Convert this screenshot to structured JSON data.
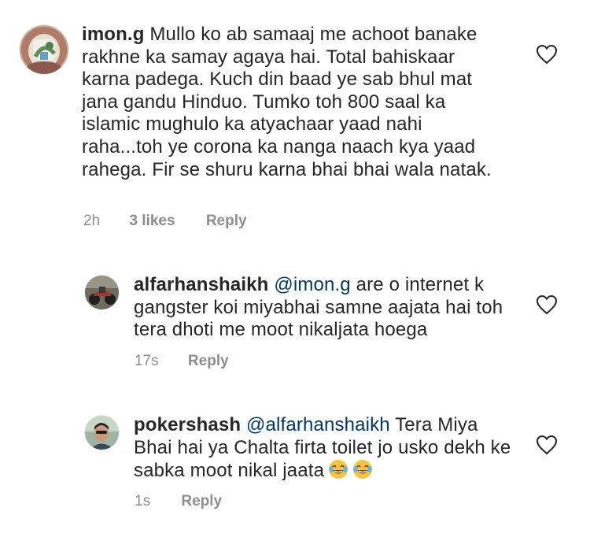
{
  "comments": [
    {
      "username": "imon.g",
      "mention": "",
      "text": "Mullo ko ab samaaj me achoot banake rakhne ka samay agaya hai. Total bahiskaar karna padega. Kuch din baad ye sab bhul mat jana gandu Hinduo. Tumko toh 800 saal ka islamic mughulo ka atyachaar yaad nahi raha...toh ye corona ka nanga naach kya yaad rahega. Fir se shuru karna bhai bhai wala natak.",
      "time": "2h",
      "likes": "3 likes",
      "reply": "Reply"
    },
    {
      "username": "alfarhanshaikh",
      "mention": "@imon.g",
      "text": "are o internet k gangster koi miyabhai samne aajata hai toh tera dhoti me moot nikaljata hoega",
      "time": "17s",
      "reply": "Reply"
    },
    {
      "username": "pokershash",
      "mention": "@alfarhanshaikh",
      "text": "Tera Miya Bhai hai ya Chalta firta toilet jo usko dekh ke sabka moot nikal jaata",
      "emojis": [
        "face-with-tears-of-joy-icon",
        "face-with-tears-of-joy-icon"
      ],
      "time": "1s",
      "reply": "Reply"
    }
  ],
  "colors": {
    "text": "#262626",
    "meta": "#8e8e8e",
    "mention": "#00376b",
    "heart": "#262626"
  }
}
